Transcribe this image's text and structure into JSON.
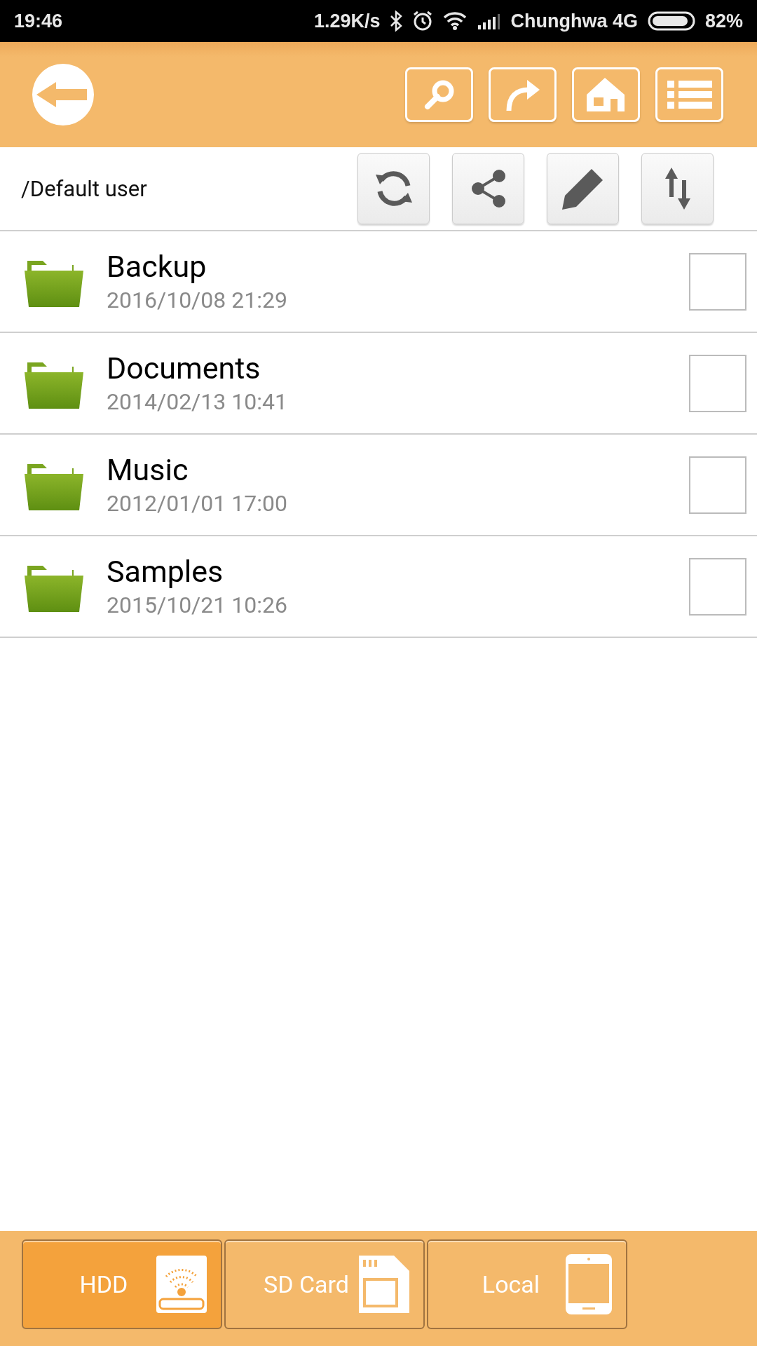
{
  "status_bar": {
    "time": "19:46",
    "speed": "1.29K/s",
    "carrier": "Chunghwa 4G",
    "battery": "82%"
  },
  "path": "/Default user",
  "files": [
    {
      "name": "Backup",
      "date": "2016/10/08 21:29",
      "checked": false
    },
    {
      "name": "Documents",
      "date": "2014/02/13 10:41",
      "checked": false
    },
    {
      "name": "Music",
      "date": "2012/01/01 17:00",
      "checked": false
    },
    {
      "name": "Samples",
      "date": "2015/10/21 10:26",
      "checked": false
    }
  ],
  "storage_tabs": [
    {
      "label": "HDD",
      "kind": "hdd",
      "selected": true
    },
    {
      "label": "SD Card",
      "kind": "sd",
      "selected": false
    },
    {
      "label": "Local",
      "kind": "phone",
      "selected": false
    }
  ]
}
